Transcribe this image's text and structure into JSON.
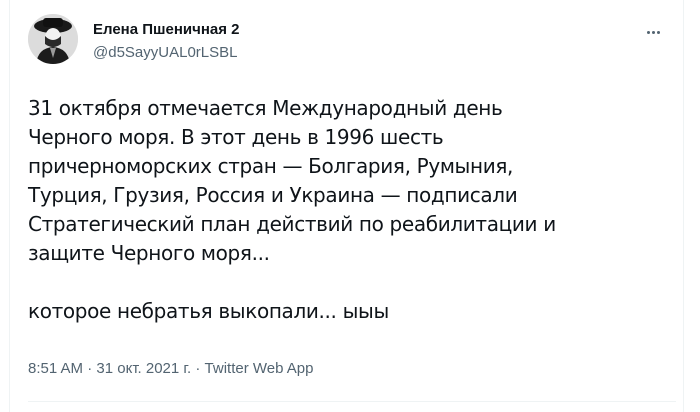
{
  "tweet": {
    "author_name": "Елена Пшеничная 2",
    "author_handle": "@d5SayyUAL0rLSBL",
    "more_icon": "more-horizontal-icon",
    "text_lines": [
      "31 октября отмечается Международный день",
      "Черного моря. В этот день в 1996 шесть",
      "причерноморских стран — Болгария, Румыния,",
      "Турция, Грузия, Россия и Украина — подписали",
      "Стратегический план действий по реабилитации и",
      "защите Черного моря..."
    ],
    "text_tail": "которое небратья выкопали... ыыы",
    "time": "8:51 AM",
    "separator": "·",
    "date": "31 окт. 2021 г.",
    "source": "Twitter Web App"
  },
  "colors": {
    "text_primary": "#0f1419",
    "text_secondary": "#536471",
    "divider": "#eff3f4"
  }
}
